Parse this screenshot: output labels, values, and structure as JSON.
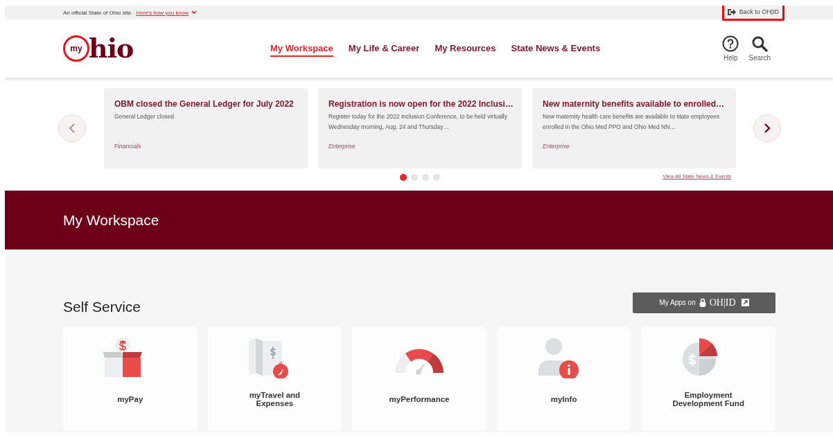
{
  "official_bar": {
    "text": "An official State of Ohio site.",
    "link": "Here's how you know",
    "back_button": {
      "label": "Back to OH|ID",
      "highlighted": true
    }
  },
  "header": {
    "logo": {
      "circle_text": "my",
      "text": "hio"
    },
    "nav": [
      {
        "label": "My Workspace",
        "selected": true
      },
      {
        "label": "My Life & Career",
        "selected": false
      },
      {
        "label": "My Resources",
        "selected": false
      },
      {
        "label": "State News & Events",
        "selected": false
      }
    ],
    "tools": [
      {
        "kind": "help",
        "label": "Help"
      },
      {
        "kind": "search",
        "label": "Search"
      }
    ]
  },
  "news": {
    "cards": [
      {
        "title": "OBM closed the General Ledger for July 2022",
        "body": "General Ledger closed",
        "category": "Financials"
      },
      {
        "title": "Registration is now open for the 2022 Inclusi…",
        "body": "Register today for the 2022 Inclusion Conference, to be held virtually Wednesday morning, Aug. 24 and Thursday…",
        "category": "Enterprise"
      },
      {
        "title": "New maternity benefits available to enrolled…",
        "body": "New maternity health care benefits are available to state employees enrolled in the Ohio Med PPO and Ohio Med NN…",
        "category": "Enterprise"
      }
    ],
    "dots": [
      {
        "selected": true
      },
      {
        "selected": false
      },
      {
        "selected": false
      },
      {
        "selected": false
      }
    ],
    "view_all": "View All State News & Events"
  },
  "banner": {
    "title": "My Workspace"
  },
  "self_service": {
    "title": "Self Service",
    "apps_button": {
      "label": "My Apps on",
      "brand": "OH|ID"
    },
    "tiles": [
      {
        "kind": "pay",
        "label": "myPay"
      },
      {
        "kind": "travel",
        "label": "myTravel and Expenses"
      },
      {
        "kind": "performance",
        "label": "myPerformance"
      },
      {
        "kind": "info",
        "label": "myInfo"
      },
      {
        "kind": "fund",
        "label": "Employment Development Fund"
      }
    ]
  }
}
